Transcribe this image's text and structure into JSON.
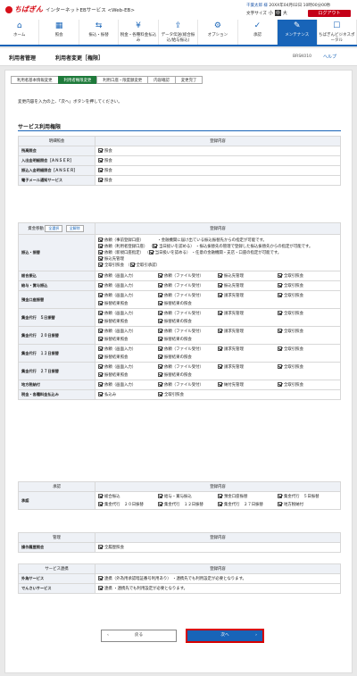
{
  "header": {
    "logo": "ちばぎん",
    "service": "インターネットEBサービス <Web-EB>",
    "user": "千葉太郎 様",
    "login_time": "20XX年04月02日 10時00分00秒",
    "font_label": "文字サイズ",
    "font_small": "小",
    "font_mid": "中",
    "font_large": "大",
    "logout": "ログアウト"
  },
  "nav": [
    {
      "label": "ホーム",
      "icon": "home-icon",
      "glyph": "⌂"
    },
    {
      "label": "照会",
      "icon": "inquiry-icon",
      "glyph": "▦"
    },
    {
      "label": "振込・振替",
      "icon": "transfer-icon",
      "glyph": "⇆"
    },
    {
      "label": "税金・各種料金払込み",
      "icon": "tax-icon",
      "glyph": "¥"
    },
    {
      "label": "データ伝送(総合振込/給与振込)",
      "icon": "data-icon",
      "glyph": "⇪"
    },
    {
      "label": "オプション",
      "icon": "option-icon",
      "glyph": "⚙"
    },
    {
      "label": "承認",
      "icon": "approve-icon",
      "glyph": "✓"
    },
    {
      "label": "メンテナンス",
      "icon": "maintenance-icon",
      "glyph": "✎"
    },
    {
      "label": "ちばぎんビジネスポータル",
      "icon": "portal-icon",
      "glyph": "☐"
    }
  ],
  "title": {
    "section": "利用者管理",
    "page": "利用者変更［権限］",
    "screen_id": "BRSK010",
    "help": "ヘルプ"
  },
  "steps": [
    "利用者基本情報変更",
    "利用者権限変更",
    "利用口座・限度額変更",
    "内容確認",
    "変更完了"
  ],
  "intro": "変更内容を入力の上、「次へ」ボタンを押してください。",
  "section_title": "サービス利用権限",
  "table1": {
    "h1": "明細照会",
    "h2": "登録内容",
    "rows": [
      {
        "label": "残高照会",
        "value": "照会"
      },
      {
        "label": "入出金明細照会［ＡＮＳＥＲ］",
        "value": "照会"
      },
      {
        "label": "振込入金明細照会［ＡＮＳＥＲ］",
        "value": "照会"
      },
      {
        "label": "電子メール通知サービス",
        "value": "照会"
      }
    ]
  },
  "table2": {
    "h1": "資金移動",
    "h2": "登録内容",
    "chip_all": "全選択",
    "chip_clear": "全解除",
    "transfer": {
      "label": "振込・振替",
      "l1a": "依頼（事前登録口座）",
      "l1b": "・金融機関に届け出ている振込振替先からの指定が可能です。",
      "l2a": "依頼（利用者登録口座）",
      "l2b": "当日扱いを認める",
      "l2c": "・振込振替先の管理で登録した振込振替先からの指定が可能です。",
      "l3a": "依頼（新規口座指定）",
      "l3b": "当日扱いを認める",
      "l3c": "・任意の金融機関・支店・口座の指定が可能です。",
      "l4": "振込先管理",
      "l5": "全取引照会",
      "l5b": "全取引承認"
    },
    "rows": [
      {
        "label": "総合振込",
        "items": [
          "依頼（画面入力）",
          "依頼（ファイル受付）",
          "振込先管理",
          "全取引照会"
        ]
      },
      {
        "label": "給与・賞与振込",
        "items": [
          "依頼（画面入力）",
          "依頼（ファイル受付）",
          "振込先管理",
          "全取引照会"
        ]
      },
      {
        "label": "預金口座振替",
        "items": [
          "依頼（画面入力）",
          "依頼（ファイル受付）",
          "請求先管理",
          "全取引照会",
          "振替結果照会",
          "振替結果の照会"
        ]
      },
      {
        "label": "集金代行　５日振替",
        "items": [
          "依頼（画面入力）",
          "依頼（ファイル受付）",
          "請求先管理",
          "全取引照会",
          "振替結果照会",
          "振替結果の照会"
        ]
      },
      {
        "label": "集金代行　２０日振替",
        "items": [
          "依頼（画面入力）",
          "依頼（ファイル受付）",
          "請求先管理",
          "全取引照会",
          "振替結果照会",
          "振替結果の照会"
        ]
      },
      {
        "label": "集金代行　１２日振替",
        "items": [
          "依頼（画面入力）",
          "依頼（ファイル受付）",
          "請求先管理",
          "全取引照会",
          "振替結果照会",
          "振替結果の照会"
        ]
      },
      {
        "label": "集金代行　２７日振替",
        "items": [
          "依頼（画面入力）",
          "依頼（ファイル受付）",
          "請求先管理",
          "全取引照会",
          "振替結果照会",
          "振替結果の照会"
        ]
      },
      {
        "label": "地方税納付",
        "items": [
          "依頼（画面入力）",
          "依頼（ファイル受付）",
          "納付先管理",
          "全取引照会"
        ]
      },
      {
        "label": "税金・各種料金払込み",
        "items": [
          "払込み",
          "全取引照会"
        ]
      }
    ]
  },
  "table3": {
    "h1": "承認",
    "h2": "登録内容",
    "label": "承認",
    "items": [
      "総合振込",
      "給与・賞与振込",
      "預金口座振替",
      "集金代行　５日振替",
      "集金代行　２０日振替",
      "集金代行　１２日振替",
      "集金代行　２７日振替",
      "地方税納付"
    ]
  },
  "table4": {
    "h1": "管理",
    "h2": "登録内容",
    "label": "操作履歴照会",
    "value": "全履歴照会"
  },
  "table5": {
    "h1": "サービス連携",
    "h2": "登録内容",
    "r1_label": "外為サービス",
    "r1_value": "連携（外為用承認暗証番号利用あり）",
    "r1_note": "・連携先でも利用設定が必要となります。",
    "r2_label": "でんさいサービス",
    "r2_value": "連携",
    "r2_note": "・連携先でも利用設定が必要となります。"
  },
  "buttons": {
    "back": "戻る",
    "next": "次へ"
  }
}
